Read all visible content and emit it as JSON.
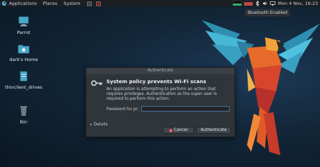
{
  "topbar": {
    "menu": [
      "Applications",
      "Places",
      "System"
    ],
    "clock": "Mon 4 Nov, 16:23"
  },
  "tooltip": "Bluetooth Enabled",
  "desktop": {
    "icons": [
      {
        "label": "Parrot",
        "icon": "computer-icon"
      },
      {
        "label": "dark's Home",
        "icon": "home-folder-icon"
      },
      {
        "label": "thinclient_drives",
        "icon": "drive-icon"
      },
      {
        "label": "Bin",
        "icon": "trash-icon"
      }
    ]
  },
  "dialog": {
    "title": "Authenticate",
    "heading": "System policy prevents Wi-Fi scans",
    "message": "An application is attempting to perform an action that requires privileges. Authentication as the super user is required to perform this action.",
    "password_label": "Password for pi:",
    "password_value": "",
    "details_label": "Details",
    "cancel_label": "Cancel",
    "authenticate_label": "Authenticate"
  },
  "colors": {
    "accent": "#4b6d93",
    "cancel_icon": "#d24545",
    "panel": "#1b1e22",
    "dialog": "#30353a"
  }
}
